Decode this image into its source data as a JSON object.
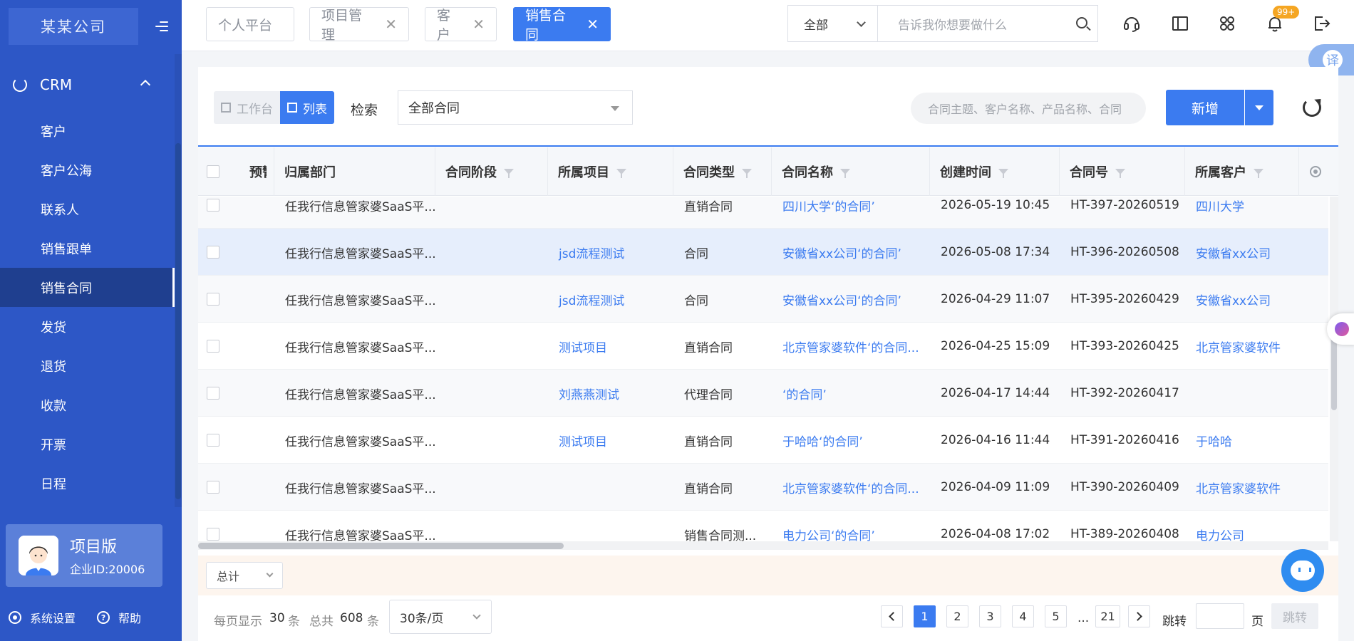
{
  "brand": {
    "logo_text": "某某公司"
  },
  "sidebar": {
    "section": "CRM",
    "items": [
      {
        "label": "客户"
      },
      {
        "label": "客户公海"
      },
      {
        "label": "联系人"
      },
      {
        "label": "销售跟单"
      },
      {
        "label": "销售合同",
        "active": true
      },
      {
        "label": "发货"
      },
      {
        "label": "退货"
      },
      {
        "label": "收款"
      },
      {
        "label": "开票"
      },
      {
        "label": "日程"
      }
    ],
    "edition": "项目版",
    "company_id": "企业ID:20006",
    "settings_label": "系统设置",
    "help_label": "帮助"
  },
  "tabs": [
    {
      "label": "个人平台",
      "closable": false
    },
    {
      "label": "项目管理",
      "closable": true
    },
    {
      "label": "客户",
      "closable": true
    },
    {
      "label": "销售合同",
      "closable": true,
      "active": true
    }
  ],
  "header": {
    "scope_value": "全部",
    "search_placeholder": "告诉我你想要做什么",
    "notification_badge": "99+",
    "translate_label": "译",
    "icons": [
      "headset-icon",
      "sidebar-layout-icon",
      "apps-grid-icon",
      "bell-icon",
      "logout-icon"
    ]
  },
  "toolbar": {
    "view_workbench": "工作台",
    "view_list": "列表",
    "search_label": "检索",
    "filter_value": "全部合同",
    "search_placeholder": "合同主题、客户名称、产品名称、合同",
    "add_label": "新增"
  },
  "table": {
    "columns": [
      "预警",
      "归属部门",
      "合同阶段",
      "所属项目",
      "合同类型",
      "合同名称",
      "创建时间",
      "合同号",
      "所属客户"
    ],
    "rows": [
      {
        "dept": "任我行信息管家婆SaaS平...",
        "stage": "",
        "project": "",
        "type": "直销合同",
        "name": "四川大学‘的合同’",
        "created": "2026-05-19 10:45",
        "no": "HT-397-20260519",
        "customer": "四川大学"
      },
      {
        "dept": "任我行信息管家婆SaaS平...",
        "stage": "",
        "project": "jsd流程测试",
        "type": "合同",
        "name": "安徽省xx公司‘的合同’",
        "created": "2026-05-08 17:34",
        "no": "HT-396-20260508",
        "customer": "安徽省xx公司"
      },
      {
        "dept": "任我行信息管家婆SaaS平...",
        "stage": "",
        "project": "jsd流程测试",
        "type": "合同",
        "name": "安徽省xx公司‘的合同’",
        "created": "2026-04-29 11:07",
        "no": "HT-395-20260429",
        "customer": "安徽省xx公司"
      },
      {
        "dept": "任我行信息管家婆SaaS平...",
        "stage": "",
        "project": "测试项目",
        "type": "直销合同",
        "name": "北京管家婆软件‘的合同...",
        "created": "2026-04-25 15:09",
        "no": "HT-393-20260425",
        "customer": "北京管家婆软件"
      },
      {
        "dept": "任我行信息管家婆SaaS平...",
        "stage": "",
        "project": "刘燕燕测试",
        "type": "代理合同",
        "name": "‘的合同’",
        "created": "2026-04-17 14:44",
        "no": "HT-392-20260417",
        "customer": ""
      },
      {
        "dept": "任我行信息管家婆SaaS平...",
        "stage": "",
        "project": "测试项目",
        "type": "直销合同",
        "name": "于哈哈‘的合同’",
        "created": "2026-04-16 11:44",
        "no": "HT-391-20260416",
        "customer": "于哈哈"
      },
      {
        "dept": "任我行信息管家婆SaaS平...",
        "stage": "",
        "project": "",
        "type": "直销合同",
        "name": "北京管家婆软件‘的合同...",
        "created": "2026-04-09 11:09",
        "no": "HT-390-20260409",
        "customer": "北京管家婆软件"
      },
      {
        "dept": "任我行信息管家婆SaaS平...",
        "stage": "",
        "project": "",
        "type": "销售合同测...",
        "name": "电力公司‘的合同’",
        "created": "2026-04-08 17:02",
        "no": "HT-389-20260408",
        "customer": "电力公司"
      }
    ]
  },
  "summary": {
    "select_value": "总计"
  },
  "pagination": {
    "per_page_label": "每页显示",
    "per_page_value": "30",
    "unit": "条",
    "total_label": "总共",
    "total_value": "608",
    "size_select": "30条/页",
    "pages": [
      "1",
      "2",
      "3",
      "4",
      "5"
    ],
    "ellipsis": "...",
    "last_page": "21",
    "current_page": "1",
    "jump_label": "跳转",
    "page_unit": "页",
    "jump_button": "跳转"
  },
  "colors": {
    "sidebar": "#2d57c6",
    "primary": "#3b7bf0",
    "badge": "#f5a623",
    "summary_bg": "#fdf5ee"
  }
}
